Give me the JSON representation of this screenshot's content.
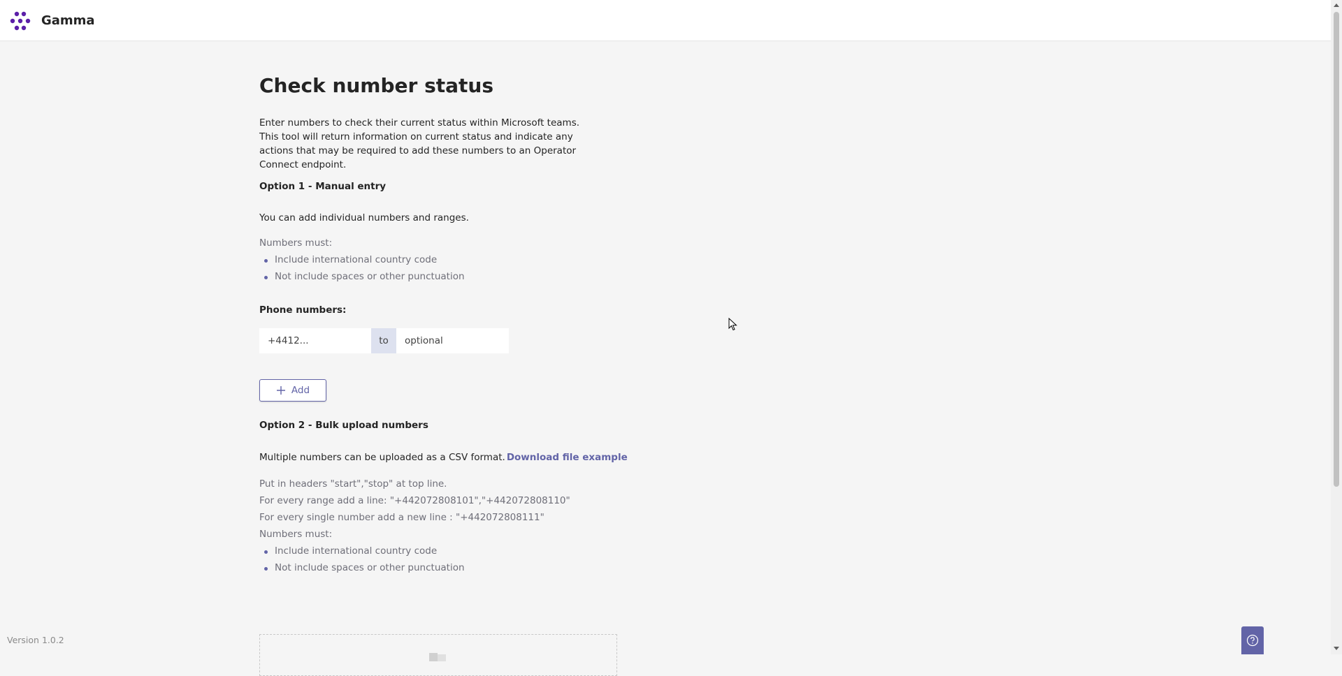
{
  "header": {
    "brand": "Gamma",
    "brand_color": "#5b1fa8"
  },
  "page": {
    "title": "Check number status",
    "intro": "Enter numbers to check their current status within Microsoft teams. This tool will return information on current status and indicate any actions that may be required to add these numbers to an Operator Connect endpoint."
  },
  "option1": {
    "title": "Option 1 - Manual entry",
    "description": "You can add individual numbers and ranges.",
    "rules_heading": "Numbers must:",
    "rules": [
      "Include international country code",
      "Not include spaces or other punctuation"
    ],
    "phone_label": "Phone numbers:",
    "from_placeholder": "+4412...",
    "to_label": "to",
    "to_placeholder": "optional",
    "add_label": "Add"
  },
  "option2": {
    "title": "Option 2 - Bulk upload numbers",
    "description": "Multiple numbers can be uploaded as a CSV format.",
    "download_link": "Download file example",
    "instructions": [
      "Put in headers \"start\",\"stop\" at top line.",
      "For every range add a line: \"+442072808101\",\"+442072808110\"",
      "For every single number add a new line : \"+442072808111\""
    ],
    "rules_heading": "Numbers must:",
    "rules": [
      "Include international country code",
      "Not include spaces or other punctuation"
    ]
  },
  "footer": {
    "version": "Version 1.0.2"
  },
  "theme": {
    "accent": "#6264a7",
    "background": "#f5f5f5"
  }
}
